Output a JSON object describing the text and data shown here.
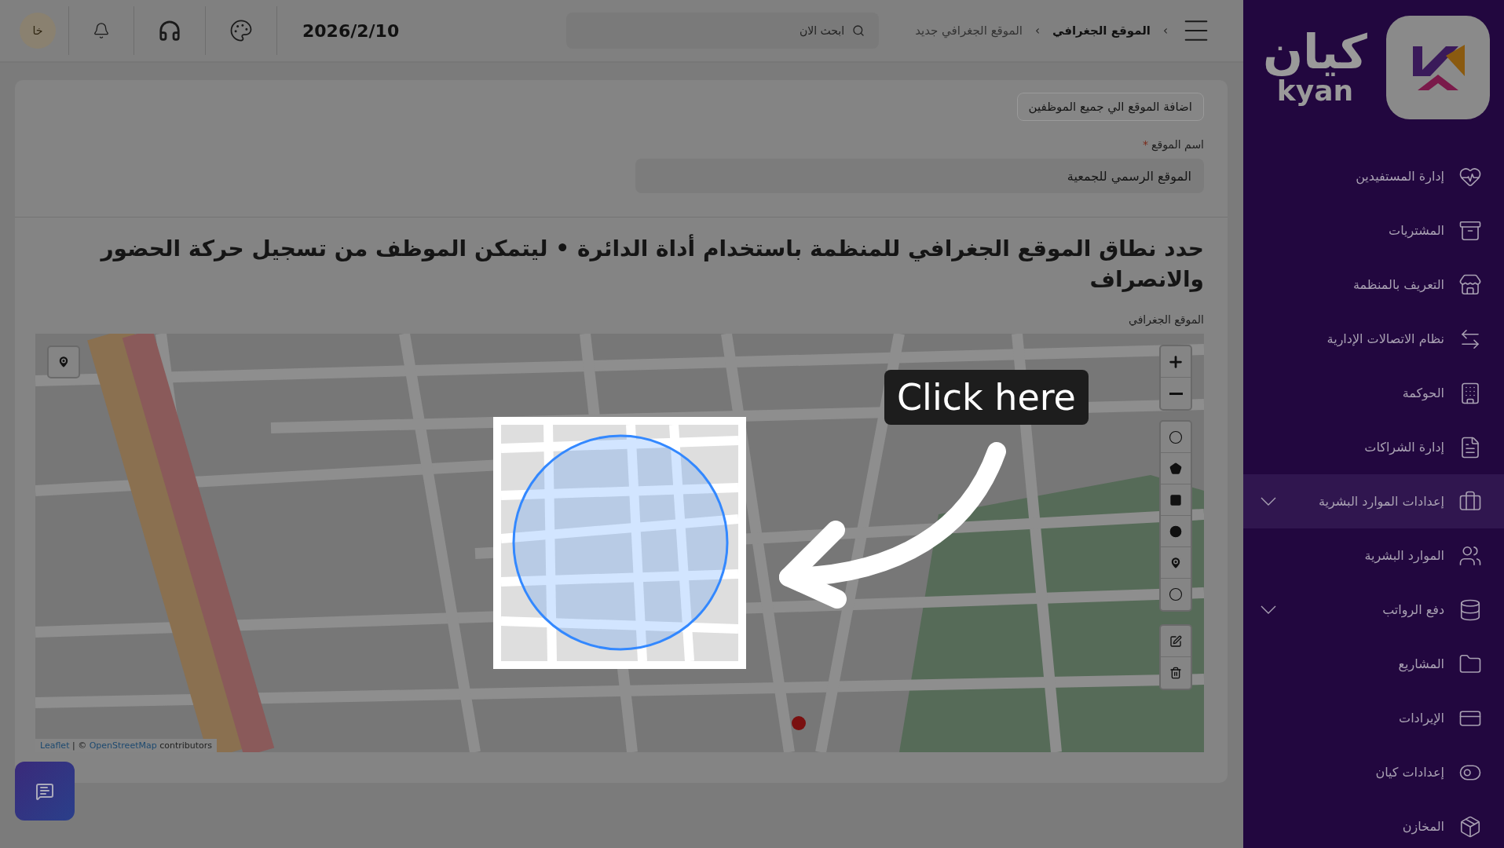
{
  "topbar": {
    "breadcrumb": [
      "الموقع الجغرافي",
      "الموقع الجغرافي جديد"
    ],
    "breadcrumb_separator": "›",
    "search_placeholder": "ابحث الان",
    "date": "2026/2/10",
    "avatar": "خا"
  },
  "sidebar": {
    "logo_ar": "كيان",
    "logo_en": "kyan",
    "items": [
      {
        "label": "إدارة المستفيدين",
        "selected": false,
        "expandable": false
      },
      {
        "label": "المشتريات",
        "selected": false,
        "expandable": false
      },
      {
        "label": "التعريف بالمنظمة",
        "selected": false,
        "expandable": false
      },
      {
        "label": "نظام الاتصالات الإدارية",
        "selected": false,
        "expandable": false
      },
      {
        "label": "الحوكمة",
        "selected": false,
        "expandable": false
      },
      {
        "label": "إدارة الشراكات",
        "selected": false,
        "expandable": false
      },
      {
        "label": "إعدادات الموارد البشرية",
        "selected": true,
        "expandable": true
      },
      {
        "label": "الموارد البشرية",
        "selected": false,
        "expandable": false
      },
      {
        "label": "دفع الرواتب",
        "selected": false,
        "expandable": true
      },
      {
        "label": "المشاريع",
        "selected": false,
        "expandable": false
      },
      {
        "label": "الإيرادات",
        "selected": false,
        "expandable": false
      },
      {
        "label": "إعدادات كيان",
        "selected": false,
        "expandable": false
      },
      {
        "label": "المخازن",
        "selected": false,
        "expandable": false
      }
    ]
  },
  "form": {
    "add_all_button": "اضافة الموقع الي جميع الموظفين",
    "name_label": "اسم الموقع",
    "required_mark": "*",
    "name_value": "الموقع الرسمي للجمعية"
  },
  "heading": "حدد نطاق الموقع الجغرافي للمنظمة باستخدام أداة الدائرة • ليتمكن الموظف من تسجيل حركة الحضور والانصراف",
  "map": {
    "label": "الموقع الجغرافي",
    "attribution": {
      "link_1": "Leaflet",
      "middle": "| ©",
      "link_2": "OpenStreetMap",
      "suffix": "contributors"
    }
  },
  "tutorial": {
    "callout": "Click here"
  }
}
